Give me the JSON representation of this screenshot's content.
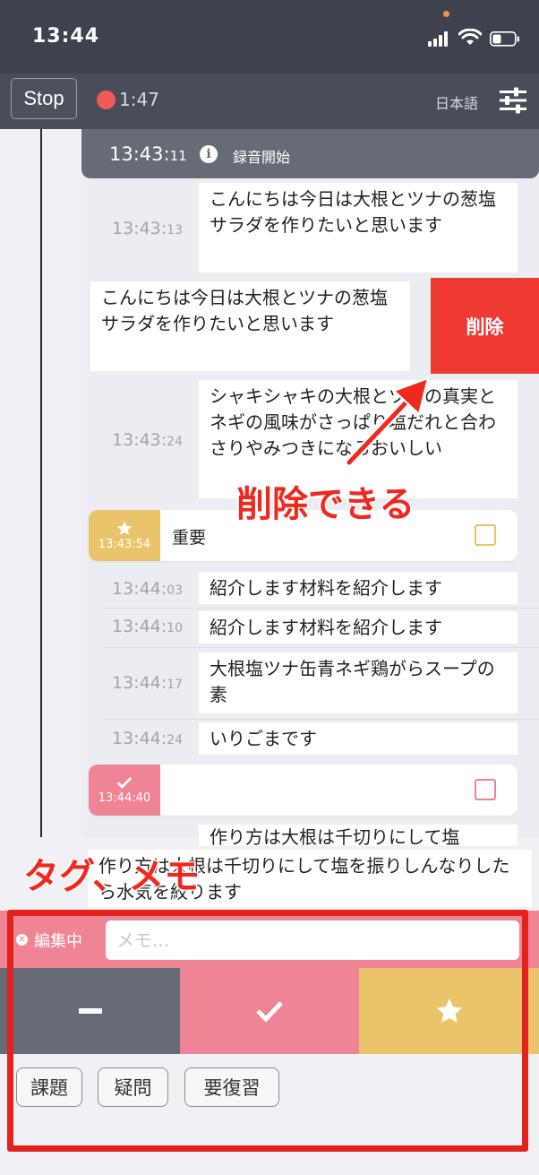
{
  "status_bar": {
    "time": "13:44"
  },
  "toolbar": {
    "stop_label": "Stop",
    "elapsed": "1:47",
    "language": "日本語"
  },
  "timeline": {
    "recording_start": {
      "time_main": "13:43:",
      "time_sec": "11",
      "label": "録音開始"
    },
    "entries": [
      {
        "time_main": "13:43:",
        "time_sec": "13",
        "text": "こんにちは今日は大根とツナの葱塩サラダを作りたいと思います"
      },
      {
        "time_main": "13:43:",
        "time_sec": "24",
        "text": "シャキシャキの大根とツナの真実とネギの風味がさっぱり塩だれと合わさりやみつきになるおいしい"
      },
      {
        "time_main": "13:44:",
        "time_sec": "03",
        "text": "紹介します材料を紹介します"
      },
      {
        "time_main": "13:44:",
        "time_sec": "10",
        "text": "紹介します材料を紹介します"
      },
      {
        "time_main": "13:44:",
        "time_sec": "17",
        "text": "大根塩ツナ缶青ネギ鶏がらスープの素"
      },
      {
        "time_main": "13:44:",
        "time_sec": "24",
        "text": "いりごまです"
      },
      {
        "text": "作り方は大根は千切りにして塩"
      }
    ],
    "swiped_entry": {
      "text": "こんにちは今日は大根とツナの葱塩サラダを作りたいと思います",
      "delete_label": "削除"
    },
    "star_tag": {
      "time": "13:43:54",
      "label": "重要",
      "color": "#e9c46a"
    },
    "check_tag": {
      "time": "13:44:40",
      "label": "",
      "color": "#ee8494"
    },
    "bottom_entry": {
      "text": "作り方は大根は千切りにして塩を振りしんなりしたら水気を絞ります"
    }
  },
  "annotations": {
    "delete_callout": "削除できる",
    "tag_memo_callout": "タグ、メモ"
  },
  "editor": {
    "editing_label": "編集中",
    "memo_placeholder": "メモ...",
    "tag_buttons": [
      {
        "icon": "minus-icon",
        "color": "#666b75"
      },
      {
        "icon": "check-icon",
        "color": "#ee8494"
      },
      {
        "icon": "star-icon",
        "color": "#e9c46a"
      }
    ],
    "chips": [
      "課題",
      "疑問",
      "要復習"
    ]
  }
}
